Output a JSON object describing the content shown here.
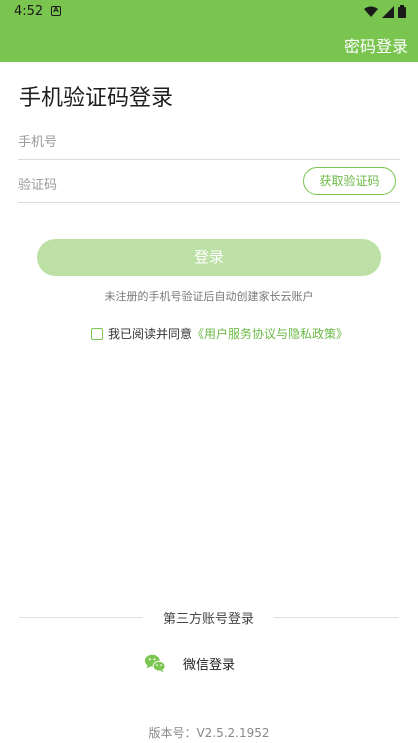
{
  "status_bar": {
    "time": "4:52",
    "notification_icon": "a-square-icon",
    "icons": [
      "wifi-icon",
      "signal-icon",
      "battery-icon"
    ]
  },
  "header": {
    "password_login_label": "密码登录",
    "background_color": "#7ac54f"
  },
  "main": {
    "title": "手机验证码登录",
    "phone_placeholder": "手机号",
    "phone_value": "",
    "code_placeholder": "验证码",
    "code_value": "",
    "get_code_label": "获取验证码",
    "login_label": "登录",
    "tip": "未注册的手机号验证后自动创建家长云账户",
    "agreement": {
      "checked": false,
      "prefix": "我已阅读并同意",
      "link": "《用户服务协议与隐私政策》"
    }
  },
  "third_party": {
    "title": "第三方账号登录",
    "wechat_label": "微信登录",
    "wechat_icon": "wechat-icon",
    "wechat_color": "#7ac54f"
  },
  "version": "版本号：V2.5.2.1952",
  "colors": {
    "accent": "#7ac54f",
    "login_button_disabled": "#bde0a6"
  }
}
